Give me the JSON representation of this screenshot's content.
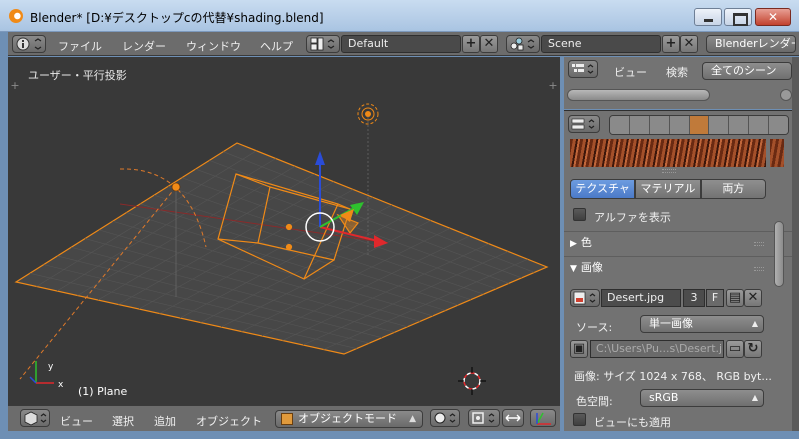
{
  "window": {
    "title": "Blender* [D:¥デスクトップcの代替¥shading.blend]",
    "close_glyph": "✕"
  },
  "info_header": {
    "menus": [
      "ファイル",
      "レンダー",
      "ウィンドウ",
      "ヘルプ"
    ],
    "screen_layout": "Default",
    "scene": "Scene",
    "render_engine": "Blenderレンダー"
  },
  "viewport": {
    "view_label": "ユーザー・平行投影",
    "object_label": "(1) Plane",
    "axis_y": "y",
    "axis_x": "x"
  },
  "view_header": {
    "menus": [
      "ビュー",
      "選択",
      "追加",
      "オブジェクト"
    ],
    "mode": "オブジェクトモード"
  },
  "outliner": {
    "menu_view": "ビュー",
    "menu_search": "検索",
    "filter": "全てのシーン"
  },
  "properties": {
    "tabs": [
      "テクスチャ",
      "マテリアル",
      "両方"
    ],
    "active_tab": 0,
    "show_alpha_label": "アルファを表示",
    "panel_color": "色",
    "panel_image": "画像",
    "image_name": "Desert.jpg",
    "image_users": "3",
    "fake_user": "F",
    "source_label": "ソース:",
    "source_value": "単一画像",
    "filepath": "C:\\Users\\Pu...s\\Desert.jpg",
    "image_info": "画像: サイズ 1024 x 768、 RGB byt...",
    "color_space_label": "色空間:",
    "color_space_value": "sRGB",
    "view_as_render_label": "ビューにも適用"
  },
  "colors": {
    "viewport_bg": "#393939",
    "selection_orange": "#f08a17",
    "active_tab_blue": "#5a8ad8",
    "axis_red": "#e0282c",
    "axis_green": "#2ec12e",
    "axis_blue": "#2a4cd8"
  }
}
